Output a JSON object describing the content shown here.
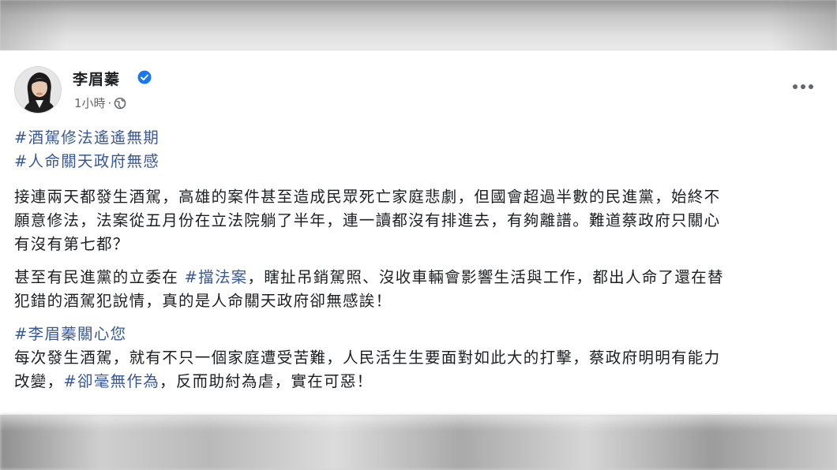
{
  "post": {
    "author": "李眉蓁",
    "time": "1小時",
    "separator": "·",
    "icons": {
      "verified": "verified-badge-icon",
      "audience": "globe-icon",
      "menu": "more-options-icon"
    },
    "accent_color": "#385898",
    "hashtags_top": [
      "#酒駕修法遙遙無期",
      "#人命關天政府無感"
    ],
    "paragraph1": {
      "line1": "接連兩天都發生酒駕，高雄的案件甚至造成民眾死亡家庭悲劇，但國會超過半數的民進黨，始終不",
      "line2": "願意修法，法案從五月份在立法院躺了半年，連一讀都沒有排進去，有夠離譜。難道蔡政府只關心",
      "line3": "有沒有第七都？"
    },
    "paragraph2": {
      "line1_before": "甚至有民進黨的立委在 ",
      "line1_tag": "#擋法案",
      "line1_after": "，瞎扯吊銷駕照、沒收車輛會影響生活與工作，都出人命了還在替",
      "line2": "犯錯的酒駕犯說情，真的是人命關天政府卻無感誒！"
    },
    "paragraph3": {
      "tag": "#李眉蓁關心您",
      "line1": "每次發生酒駕，就有不只一個家庭遭受苦難，人民活生生要面對如此大的打擊，蔡政府明明有能力",
      "line2_before": "改變，",
      "line2_tag": "#卻毫無作為",
      "line2_after": "，反而助紂為虐，實在可惡！"
    }
  }
}
